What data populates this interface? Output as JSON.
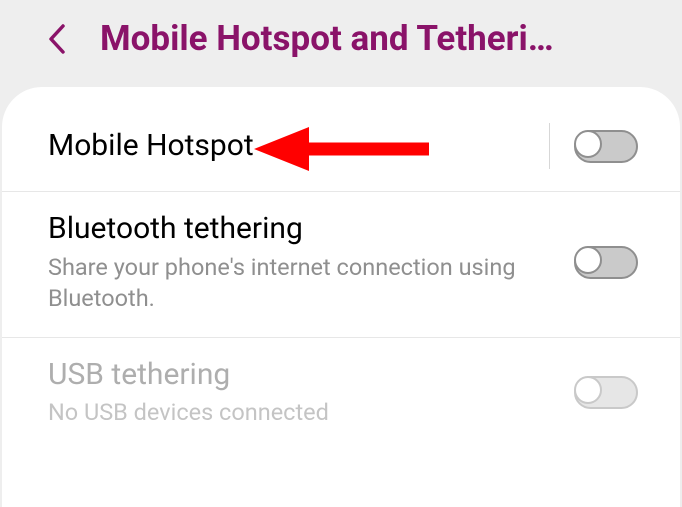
{
  "header": {
    "title": "Mobile Hotspot and Tetheri…"
  },
  "settings": [
    {
      "id": "mobile-hotspot",
      "title": "Mobile Hotspot",
      "subtitle": null,
      "enabled": true,
      "on": false,
      "has_separator": true,
      "has_arrow_annotation": true
    },
    {
      "id": "bluetooth-tethering",
      "title": "Bluetooth tethering",
      "subtitle": "Share your phone's internet connection using Bluetooth.",
      "enabled": true,
      "on": false,
      "has_separator": false,
      "has_arrow_annotation": false
    },
    {
      "id": "usb-tethering",
      "title": "USB tethering",
      "subtitle": "No USB devices connected",
      "enabled": false,
      "on": false,
      "has_separator": false,
      "has_arrow_annotation": false
    }
  ],
  "colors": {
    "accent": "#8a1369",
    "arrow": "#ff0000"
  }
}
